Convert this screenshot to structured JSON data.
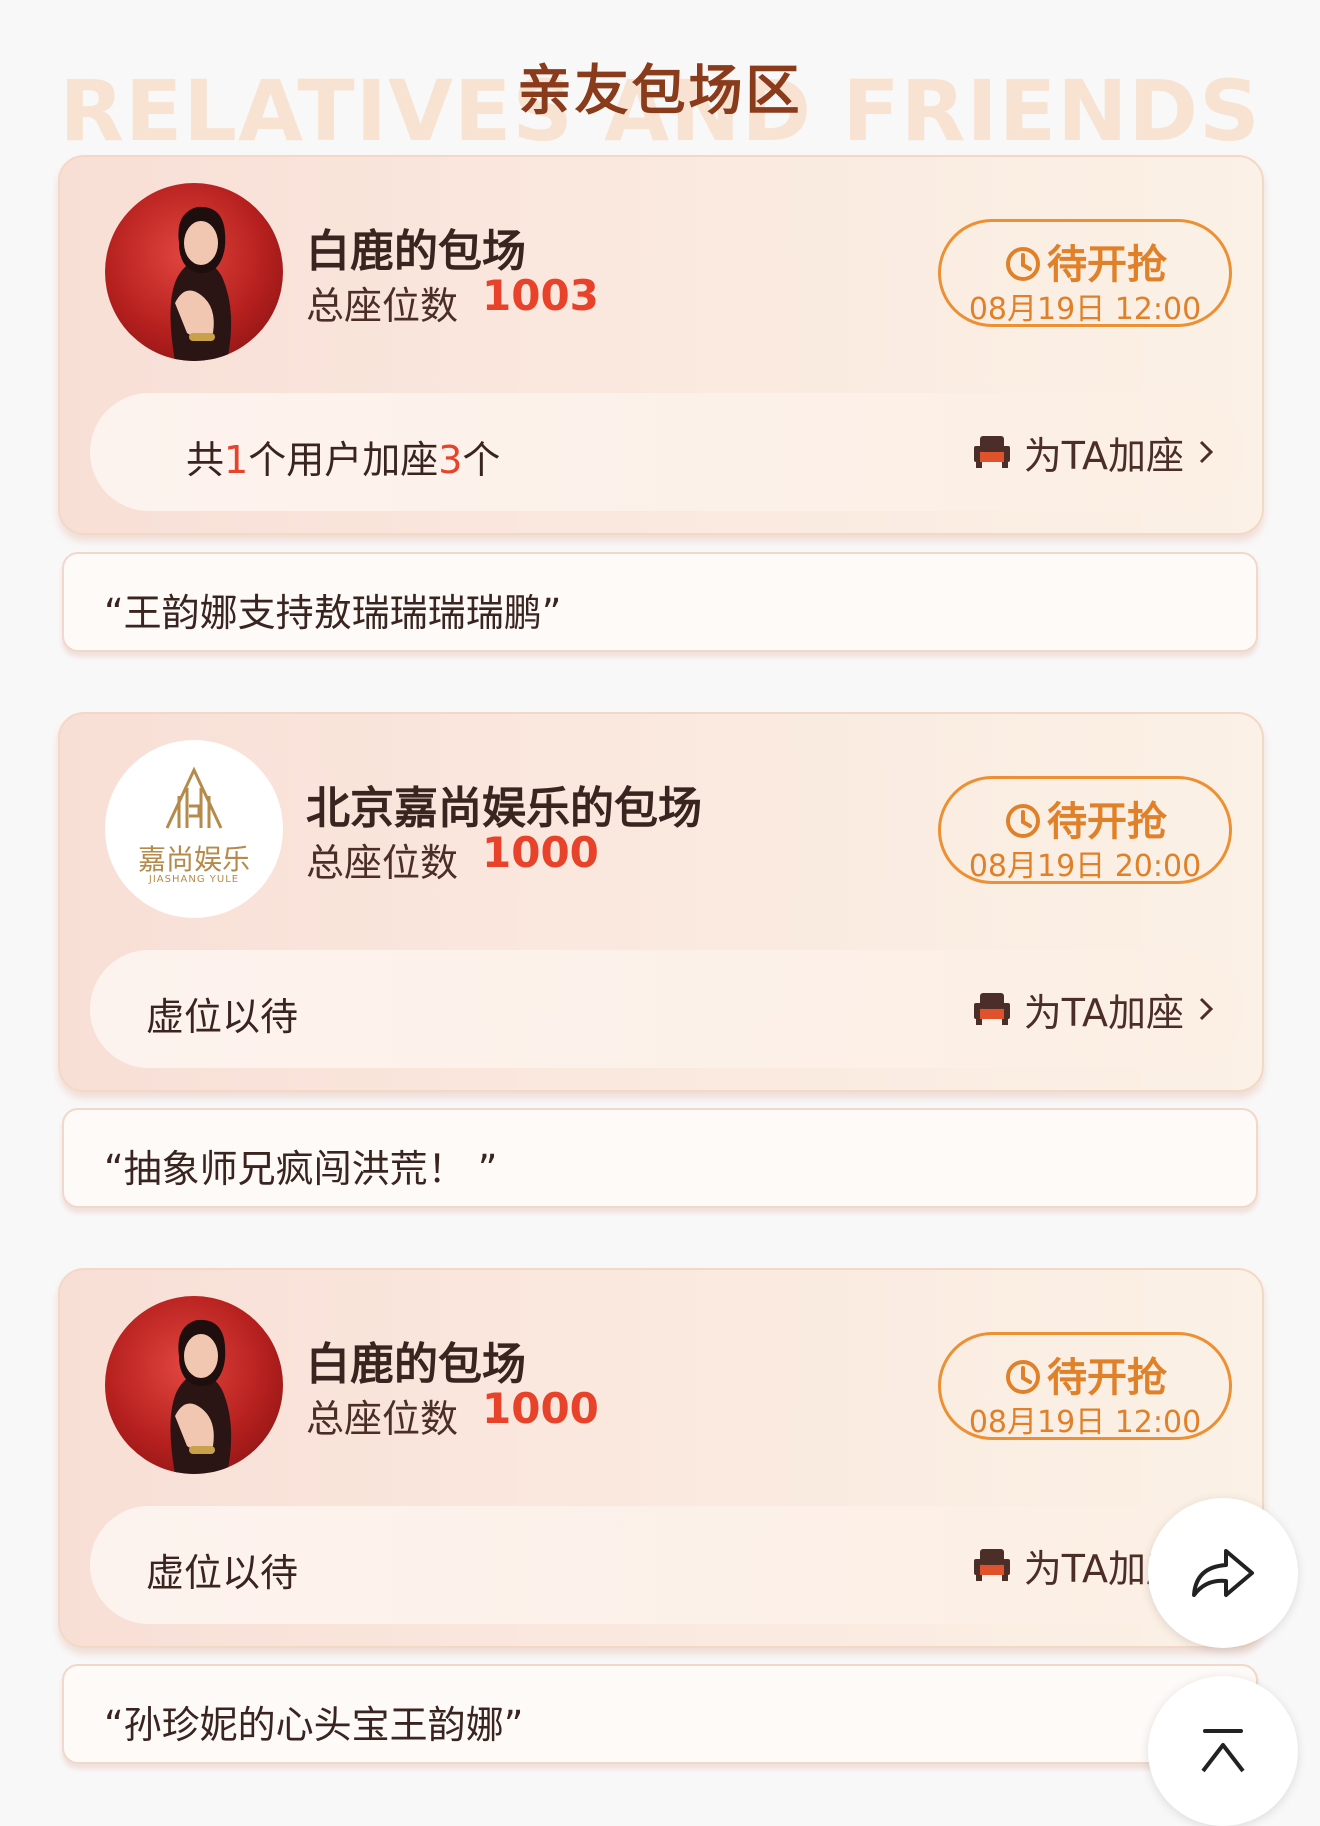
{
  "header": {
    "title": "亲友包场区",
    "bg_title": "RELATIVES AND FRIENDS"
  },
  "cards": [
    {
      "title": "白鹿的包场",
      "seats_label": "总座位数",
      "seats_total": "1003",
      "status_label": "待开抢",
      "status_time": "08月19日 12:00",
      "supporters_pre": "共",
      "supporters_users": "1",
      "supporters_mid": "个用户加座",
      "supporters_seats": "3",
      "supporters_post": "个",
      "seat_action": "为TA加座",
      "message": "“王韵娜支持敖瑞瑞瑞瑞鹏”",
      "avatar_icon": "person-photo"
    },
    {
      "title": "北京嘉尚娱乐的包场",
      "seats_label": "总座位数",
      "seats_total": "1000",
      "status_label": "待开抢",
      "status_time": "08月19日 20:00",
      "pill_text": "虚位以待",
      "seat_action": "为TA加座",
      "message": "“抽象师兄疯闯洪荒！ ”",
      "avatar_icon": "company-logo",
      "logo_text": "嘉尚娱乐",
      "logo_sub": "JIASHANG YULE"
    },
    {
      "title": "白鹿的包场",
      "seats_label": "总座位数",
      "seats_total": "1000",
      "status_label": "待开抢",
      "status_time": "08月19日 12:00",
      "pill_text": "虚位以待",
      "seat_action": "为TA加座",
      "message": "“孙珍妮的心头宝王韵娜”",
      "avatar_icon": "person-photo"
    }
  ],
  "floating": {
    "share_icon": "share-icon",
    "top_icon": "back-to-top-icon"
  },
  "colors": {
    "accent_orange": "#ec9033",
    "accent_red": "#e8422a",
    "title_brown": "#8a3b1b"
  }
}
